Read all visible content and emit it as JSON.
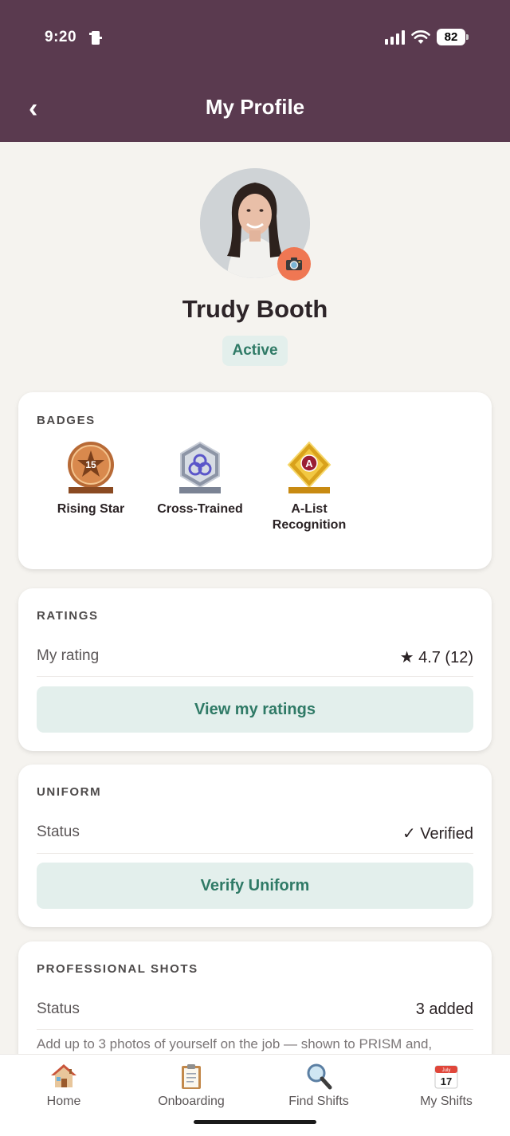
{
  "status_bar": {
    "time": "9:20",
    "battery": "82"
  },
  "header": {
    "back_glyph": "‹",
    "title": "My Profile"
  },
  "profile": {
    "name": "Trudy Booth",
    "status": "Active"
  },
  "badges": {
    "title": "BADGES",
    "items": [
      {
        "label": "Rising Star",
        "icon": "rising-star-badge-icon",
        "emblem_text": "15"
      },
      {
        "label": "Cross-Trained",
        "icon": "cross-trained-badge-icon"
      },
      {
        "label": "A-List Recognition",
        "icon": "a-list-badge-icon",
        "emblem_text": "A"
      }
    ]
  },
  "ratings": {
    "title": "RATINGS",
    "row_label": "My rating",
    "row_value": "★ 4.7 (12)",
    "button": "View my ratings"
  },
  "uniform": {
    "title": "UNIFORM",
    "row_label": "Status",
    "row_value": "✓ Verified",
    "button": "Verify Uniform"
  },
  "professional_shots": {
    "title": "PROFESSIONAL SHOTS",
    "row_label": "Status",
    "row_value": "3 added",
    "description": "Add up to 3 photos of yourself on the job — shown to PRISM and,"
  },
  "nav": {
    "items": [
      {
        "label": "Home",
        "icon": "home-icon"
      },
      {
        "label": "Onboarding",
        "icon": "clipboard-icon"
      },
      {
        "label": "Find Shifts",
        "icon": "magnifier-icon"
      },
      {
        "label": "My Shifts",
        "icon": "calendar-icon",
        "calendar_month": "July",
        "calendar_day": "17"
      }
    ]
  },
  "colors": {
    "header_bg": "#5a3a4f",
    "accent_green": "#2f7a66",
    "pill_bg": "#e3efec",
    "camera_orange": "#ef7753",
    "page_bg": "#f5f3ef"
  }
}
